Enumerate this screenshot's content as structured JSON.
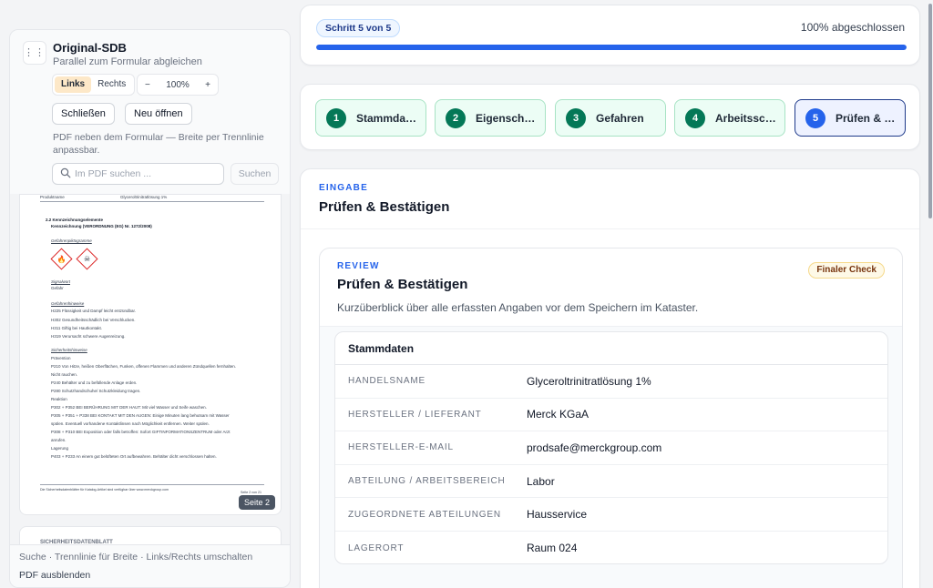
{
  "pdf_panel": {
    "title": "Original-SDB",
    "subtitle": "Parallel zum Formular abgleichen",
    "side_options": [
      "Links",
      "Rechts"
    ],
    "side_selected": "Links",
    "zoom_minus": "−",
    "zoom_level": "100%",
    "zoom_plus": "+",
    "close_label": "Schließen",
    "reopen_label": "Neu öffnen",
    "hint": "PDF neben dem Formular — Breite per Trennlinie anpassbar.",
    "search_placeholder": "Im PDF suchen ...",
    "search_button": "Suchen",
    "page_badge": "Seite 2",
    "next_page_heading": "SICHERHEITSDATENBLATT",
    "footer_hint": "Suche · Trennlinie für Breite · Links/Rechts umschalten",
    "hide_label": "PDF ausblenden"
  },
  "pdf_page": {
    "header_left": "Produktname",
    "header_right": "Glyceroltrinitratlösung 1%",
    "section": "2.2 Kennzeichnungselemente",
    "regulation": "Kennzeichnung (VERORDNUNG (EG) Nr. 1272/2008)",
    "pictograms_label": "Gefahrenpiktogramme",
    "signal_label": "Signalwort",
    "signal_word": "Gefahr",
    "hazard_label": "Gefahrenhinweise",
    "hazards": [
      "H225 Flüssigkeit und Dampf leicht entzündbar.",
      "H302 Gesundheitsschädlich bei Verschlucken.",
      "H311 Giftig bei Hautkontakt.",
      "H319 Verursacht schwere Augenreizung."
    ],
    "precaution_label": "Sicherheitshinweise",
    "precautions": [
      "Prävention",
      "P210 Von Hitze, heißen Oberflächen, Funken, offenen Flammen und anderen Zündquellen fernhalten.",
      "Nicht rauchen.",
      "P240 Behälter und zu befüllende Anlage erden.",
      "P280 Schutzhandschuhe/ Schutzkleidung tragen.",
      "Reaktion",
      "P302 + P352 BEI BERÜHRUNG MIT DER HAUT: Mit viel Wasser und Seife waschen.",
      "P305 + P351 + P338 BEI KONTAKT MIT DEN AUGEN: Einige Minuten lang behutsam mit Wasser",
      "spülen. Eventuell vorhandene Kontaktlinsen nach Möglichkeit entfernen. Weiter spülen.",
      "P308 + P310 BEI Exposition oder falls betroffen: Sofort GIFTINFORMATIONSZENTRUM oder Arzt",
      "anrufen.",
      "Lagerung",
      "P403 + P233 An einem gut belüfteten Ort aufbewahren. Behälter dicht verschlossen halten."
    ],
    "footer_left": "Die Sicherheitsdatenblätter für Katalog-Artikel sind verfügbar über www.merckgroup.com",
    "footer_right": "Seite 2 von 21"
  },
  "progress": {
    "step_badge": "Schritt 5 von 5",
    "status": "100% abgeschlossen",
    "fraction": 1.0,
    "accent": "#2563eb"
  },
  "steps": [
    {
      "num": "1",
      "label": "Stammdaten"
    },
    {
      "num": "2",
      "label": "Eigenschaften"
    },
    {
      "num": "3",
      "label": "Gefahren"
    },
    {
      "num": "4",
      "label": "Arbeitsschutz"
    },
    {
      "num": "5",
      "label": "Prüfen & Bestätigen"
    }
  ],
  "main": {
    "eyebrow": "EINGABE",
    "title": "Prüfen & Bestätigen",
    "review": {
      "eyebrow": "REVIEW",
      "title": "Prüfen & Bestätigen",
      "subtitle": "Kurzüberblick über alle erfassten Angaben vor dem Speichern im Kataster.",
      "badge": "Finaler Check",
      "section_title": "Stammdaten",
      "rows": [
        {
          "key": "HANDELSNAME",
          "value": "Glyceroltrinitratlösung 1%"
        },
        {
          "key": "HERSTELLER / LIEFERANT",
          "value": "Merck KGaA"
        },
        {
          "key": "HERSTELLER-E-MAIL",
          "value": "prodsafe@merckgroup.com"
        },
        {
          "key": "ABTEILUNG / ARBEITSBEREICH",
          "value": "Labor"
        },
        {
          "key": "ZUGEORDNETE ABTEILUNGEN",
          "value": "Hausservice"
        },
        {
          "key": "LAGERORT",
          "value": "Raum 024"
        }
      ]
    }
  }
}
